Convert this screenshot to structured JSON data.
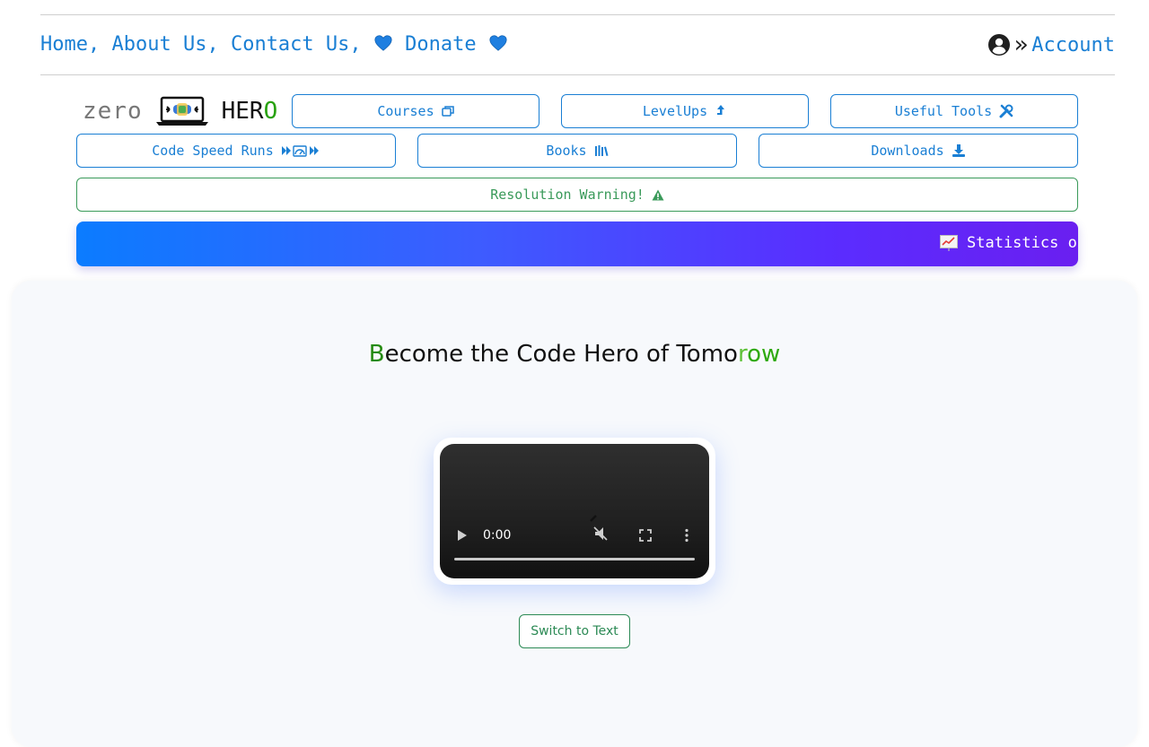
{
  "top_nav": {
    "home": "Home,",
    "about": "About Us,",
    "contact": "Contact Us,",
    "donate": "Donate",
    "account": "Account",
    "raquo": "»"
  },
  "logo": {
    "zero": "zero",
    "hero_main": "HER",
    "hero_last": "O"
  },
  "menu": {
    "courses": "Courses",
    "levelups": "LevelUps",
    "tools": "Useful Tools",
    "speedruns": "Code Speed Runs",
    "books": "Books",
    "downloads": "Downloads",
    "warning": "Resolution Warning!"
  },
  "ticker": {
    "text": "Statistics on"
  },
  "hero": {
    "b": "B",
    "mid": "ecome the Code Hero of Tomo",
    "r": "r",
    "ow": "ow"
  },
  "video": {
    "time": "0:00"
  },
  "switch_button": "Switch to Text",
  "colors": {
    "link": "#1a7fd4",
    "warning": "#3a9a5a",
    "accent_green": "#28a10e"
  },
  "icons": [
    "blue-heart-icon",
    "user-circle-icon",
    "window-icon",
    "arrow-up-icon",
    "tools-icon",
    "fast-forward-icon",
    "books-icon",
    "download-icon",
    "warning-icon",
    "chart-icon",
    "laptop-logo-icon"
  ]
}
